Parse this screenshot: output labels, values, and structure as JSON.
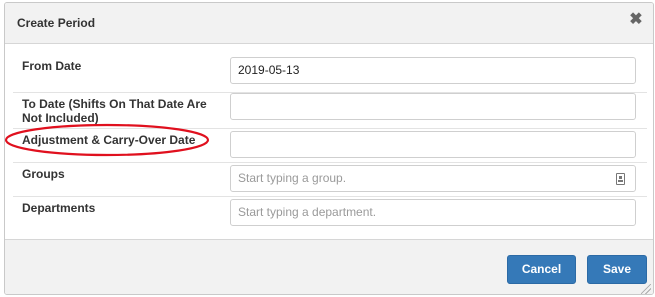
{
  "dialog": {
    "title": "Create Period",
    "close_icon": "close-icon"
  },
  "form": {
    "from_date": {
      "label": "From Date",
      "value": "2019-05-13"
    },
    "to_date": {
      "label": "To Date (Shifts On That Date Are Not Included)",
      "value": ""
    },
    "adjustment_date": {
      "label": "Adjustment & Carry-Over Date",
      "value": ""
    },
    "groups": {
      "label": "Groups",
      "placeholder": "Start typing a group.",
      "icon": "picker-icon"
    },
    "departments": {
      "label": "Departments",
      "placeholder": "Start typing a department."
    }
  },
  "footer": {
    "cancel_label": "Cancel",
    "save_label": "Save"
  },
  "colors": {
    "button_primary": "#3579b8",
    "annotation_circle": "#e0101e"
  }
}
